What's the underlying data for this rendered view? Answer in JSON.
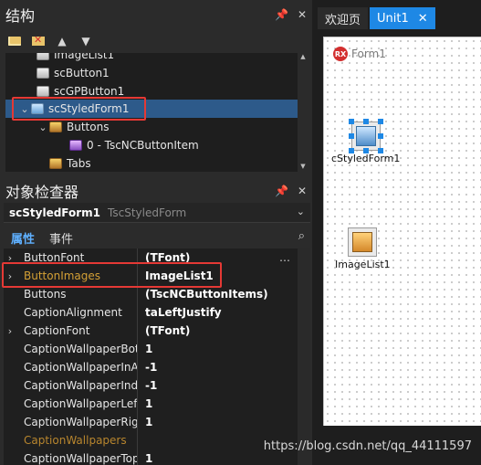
{
  "structure_panel": {
    "title": "结构",
    "pin_glyph": "📌",
    "close_glyph": "✕",
    "toolbar_icons": [
      "open-folder-icon",
      "delete-folder-icon",
      "up-arrow-icon",
      "down-arrow-icon"
    ],
    "tree": [
      {
        "label": "ImageList1",
        "icon": "component-icon",
        "indent": 1
      },
      {
        "label": "scButton1",
        "icon": "component-icon",
        "indent": 1
      },
      {
        "label": "scGPButton1",
        "icon": "component-icon",
        "indent": 1
      },
      {
        "label": "scStyledForm1",
        "icon": "form-component-icon",
        "indent": 0,
        "selected": true,
        "expanded": true
      },
      {
        "label": "Buttons",
        "icon": "buttons-collection-icon",
        "indent": 1,
        "expanded": true
      },
      {
        "label": "0 - TscNCButtonItem",
        "icon": "button-item-icon",
        "indent": 2
      },
      {
        "label": "Tabs",
        "icon": "buttons-collection-icon",
        "indent": 1
      }
    ]
  },
  "inspector": {
    "title": "对象检查器",
    "object_name": "scStyledForm1",
    "object_class": "TscStyledForm",
    "tabs": [
      "属性",
      "事件"
    ],
    "active_tab": "属性",
    "properties": [
      {
        "name": "ButtonFont",
        "value": "(TFont)",
        "expandable": true,
        "ellipsis": true
      },
      {
        "name": "ButtonImages",
        "value": "ImageList1",
        "expandable": true,
        "highlight": true
      },
      {
        "name": "Buttons",
        "value": "(TscNCButtonItems)"
      },
      {
        "name": "CaptionAlignment",
        "value": "taLeftJustify"
      },
      {
        "name": "CaptionFont",
        "value": "(TFont)",
        "expandable": true
      },
      {
        "name": "CaptionWallpaperBotto",
        "value": "1"
      },
      {
        "name": "CaptionWallpaperInAct",
        "value": "-1"
      },
      {
        "name": "CaptionWallpaperIndex",
        "value": "-1"
      },
      {
        "name": "CaptionWallpaperLeftM",
        "value": "1"
      },
      {
        "name": "CaptionWallpaperRight",
        "value": "1"
      },
      {
        "name": "CaptionWallpapers",
        "value": "",
        "dim": true
      },
      {
        "name": "CaptionWallpaperTopM",
        "value": "1"
      }
    ]
  },
  "designer": {
    "tabs": [
      {
        "label": "欢迎页",
        "active": false
      },
      {
        "label": "Unit1",
        "active": true,
        "close": "✕"
      }
    ],
    "form_caption": "Form1",
    "rx_logo": "RX",
    "components": [
      {
        "label": "cStyledForm1",
        "icon": "styled-form-icon",
        "selected": true
      },
      {
        "label": "ImageList1",
        "icon": "image-list-icon",
        "selected": false
      }
    ]
  },
  "watermark": "https://blog.csdn.net/qq_44111597"
}
